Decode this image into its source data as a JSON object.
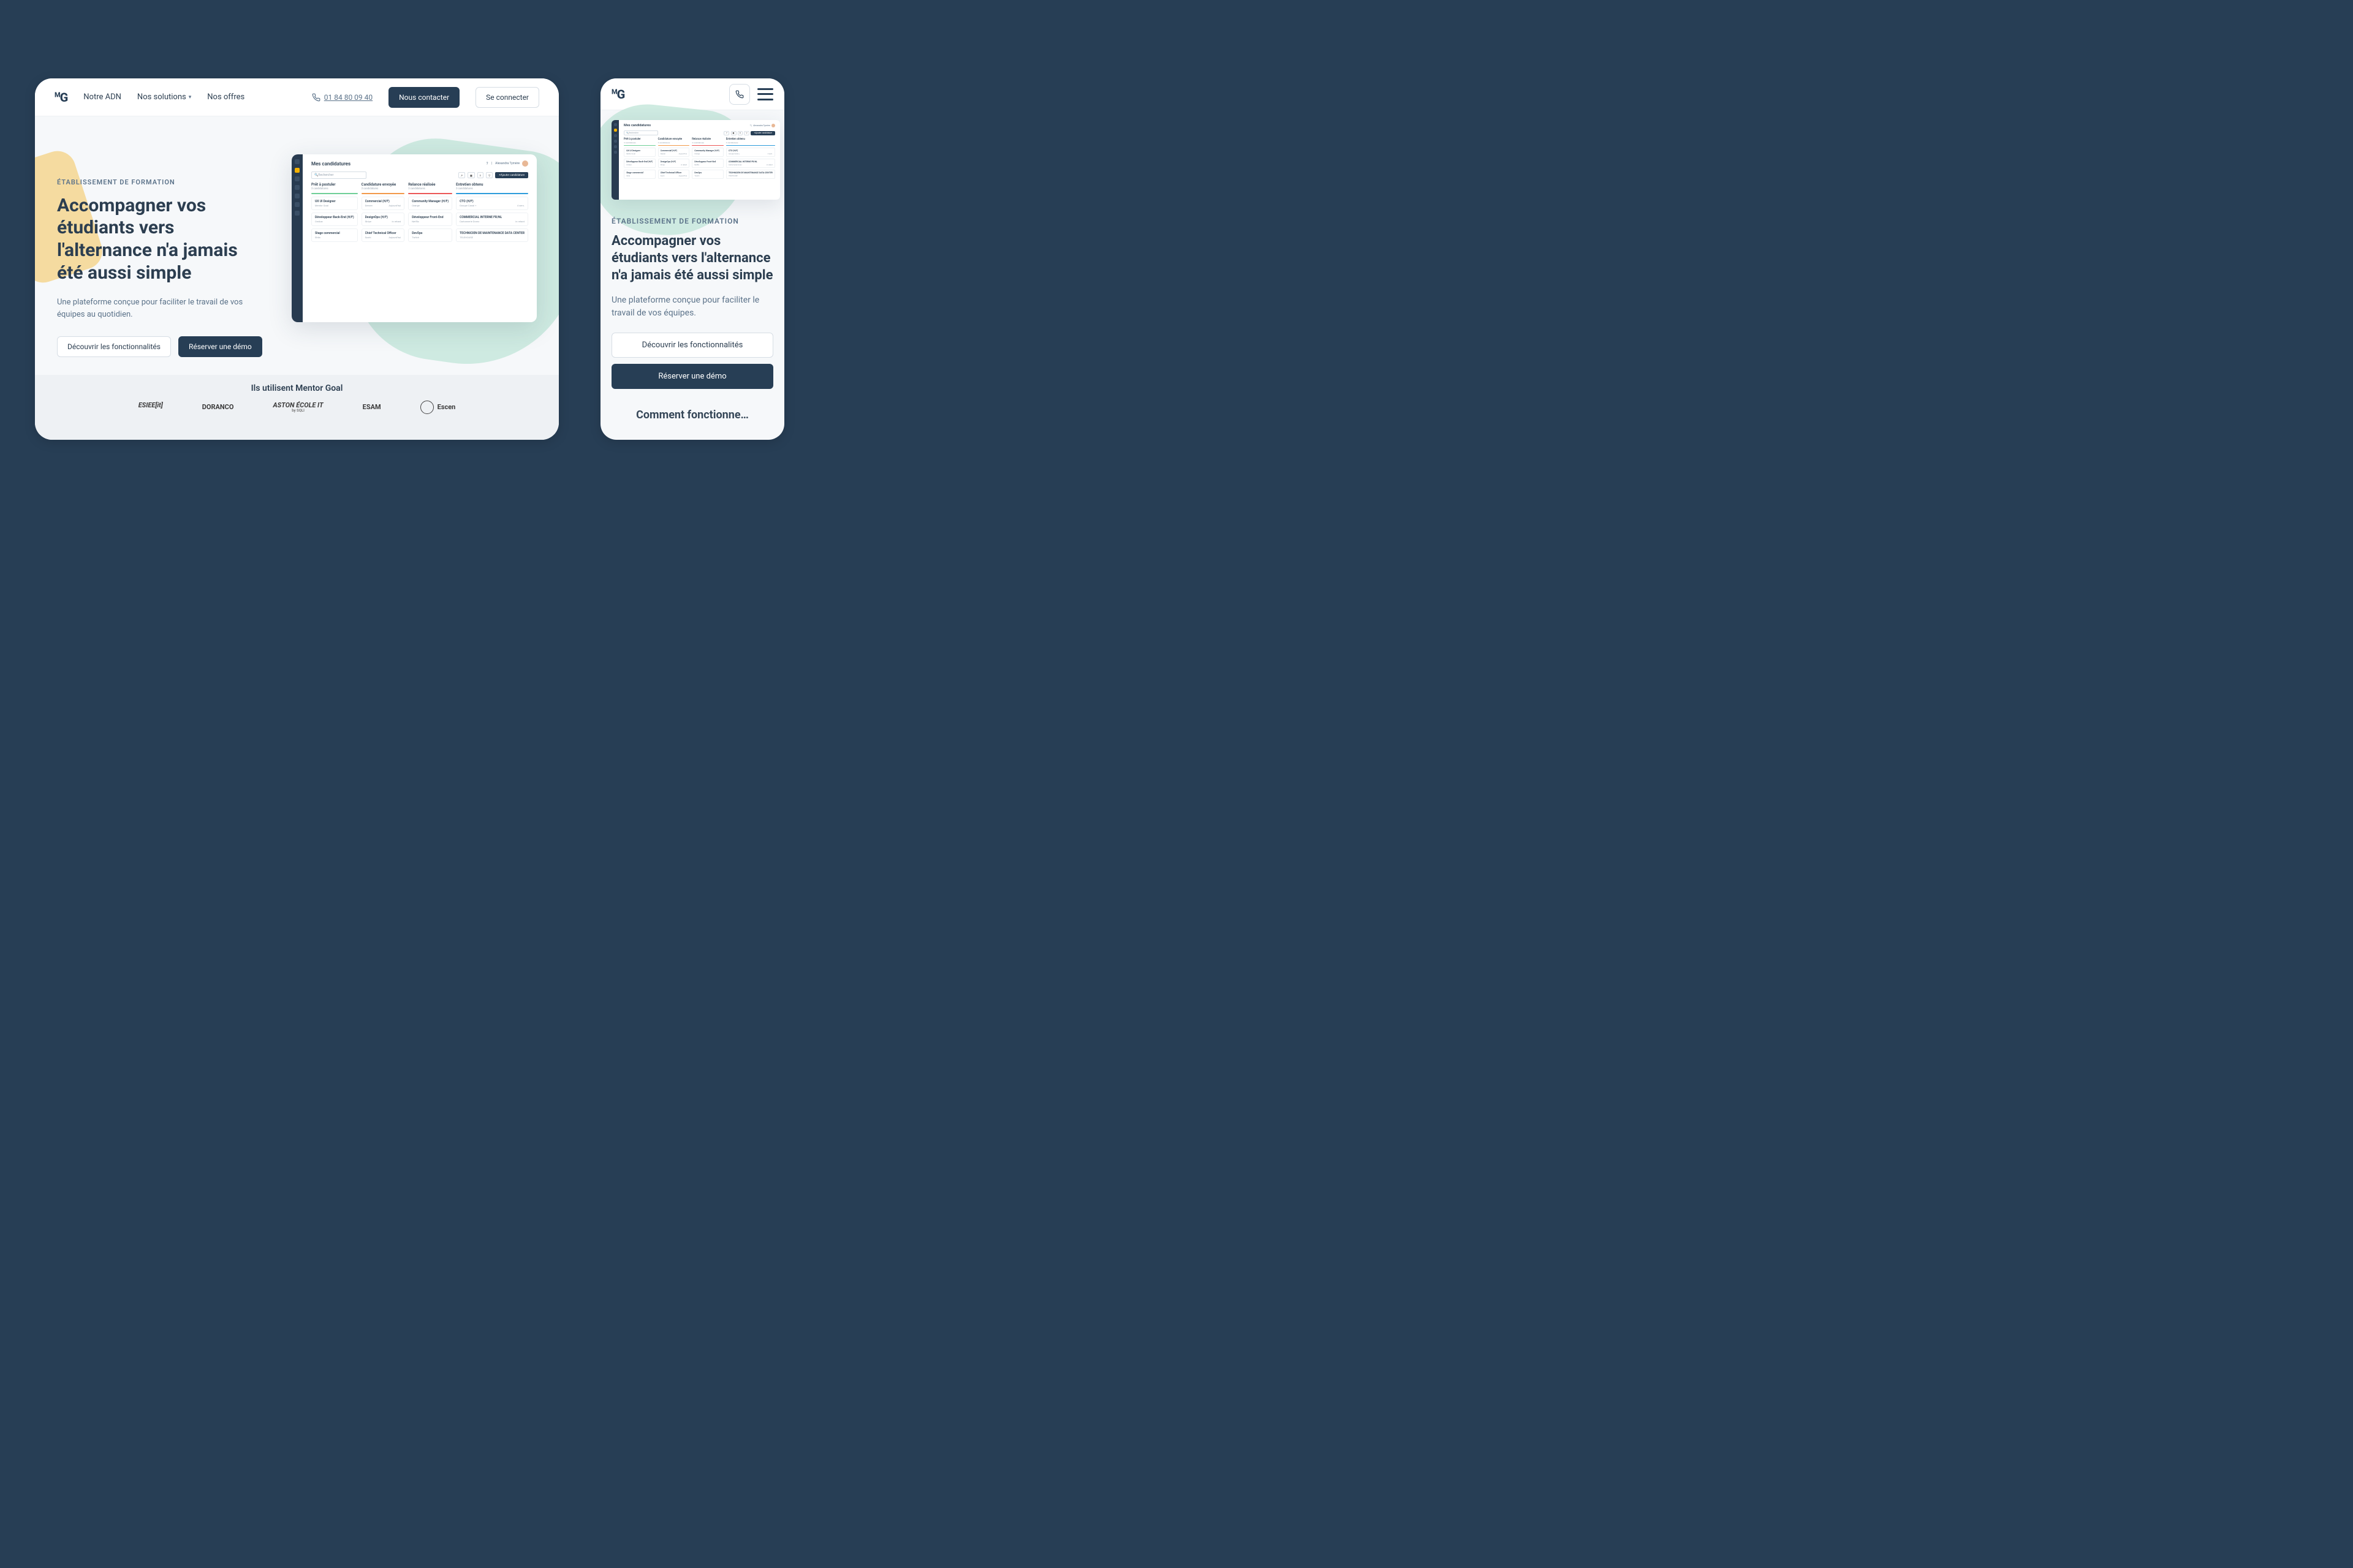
{
  "brand": {
    "name": "MG"
  },
  "nav": {
    "items": [
      {
        "label": "Notre ADN"
      },
      {
        "label": "Nos solutions",
        "has_dropdown": true
      },
      {
        "label": "Nos offres"
      }
    ],
    "phone": "01 84 80 09 40",
    "contact_btn": "Nous contacter",
    "login_btn": "Se connecter"
  },
  "hero": {
    "eyebrow": "ÉTABLISSEMENT DE FORMATION",
    "title": "Accompagner vos étudiants vers l'alternance n'a jamais été aussi simple",
    "subtitle_desktop": "Une plateforme conçue pour faciliter le travail de vos équipes au quotidien.",
    "subtitle_mobile": "Une plateforme conçue pour faciliter le travail de vos équipes.",
    "discover_btn": "Découvrir les fonctionnalités",
    "demo_btn": "Réserver une démo"
  },
  "app_mock": {
    "page_title": "Mes candidatures",
    "user_name": "Alexandra Tymère",
    "search_placeholder": "Rechercher",
    "add_btn": "Ajouter candidature",
    "columns": [
      {
        "title": "Prêt à postuler",
        "count": "3 candidatures",
        "cards": [
          {
            "title": "UX UI Designer",
            "company": "Mentor Goal",
            "meta": ""
          },
          {
            "title": "Développeur Back-End (H/F)",
            "company": "Ornikar",
            "meta": ""
          },
          {
            "title": "Stage commercial",
            "company": "Shila",
            "meta": ""
          }
        ]
      },
      {
        "title": "Candidature envoyée",
        "count": "3 candidatures",
        "cards": [
          {
            "title": "Commercial (H/F)",
            "company": "Deezer",
            "meta": "Aujourd'hui"
          },
          {
            "title": "DesignOps (H/F)",
            "company": "Stripe",
            "meta": "in retard"
          },
          {
            "title": "Chief Technical Officer",
            "company": "Sushi",
            "meta": "Aujourd'hui"
          }
        ]
      },
      {
        "title": "Relance réalisée",
        "count": "3 candidatures",
        "cards": [
          {
            "title": "Community Manager (H/F)",
            "company": "Orange",
            "meta": ""
          },
          {
            "title": "Développeur Front-End",
            "company": "Netflix",
            "meta": ""
          },
          {
            "title": "DevOps",
            "company": "Twitch",
            "meta": ""
          }
        ]
      },
      {
        "title": "Entretien obtenu",
        "count": "3 candidatures",
        "cards": [
          {
            "title": "CTO (H/F)",
            "company": "Groupe Canal +",
            "meta": "4 sem."
          },
          {
            "title": "COMMERCIAL INTERNE FR/NL",
            "company": "Cartonnerie Dorez",
            "meta": "in retard"
          },
          {
            "title": "TECHNICIEN DE MAINTENANCE DATA CENTER",
            "company": "TELEHOUSE",
            "meta": ""
          }
        ]
      }
    ]
  },
  "logos": {
    "heading": "Ils utilisent Mentor Goal",
    "partners": [
      {
        "name": "ESIEE[it]"
      },
      {
        "name": "DORANCO"
      },
      {
        "name": "ASTON ÉCOLE IT",
        "tagline": "by SQLI"
      },
      {
        "name": "ESAM"
      },
      {
        "name": "Escen",
        "tagline": ""
      }
    ]
  },
  "mobile_next_heading": "Comment fonctionne…"
}
